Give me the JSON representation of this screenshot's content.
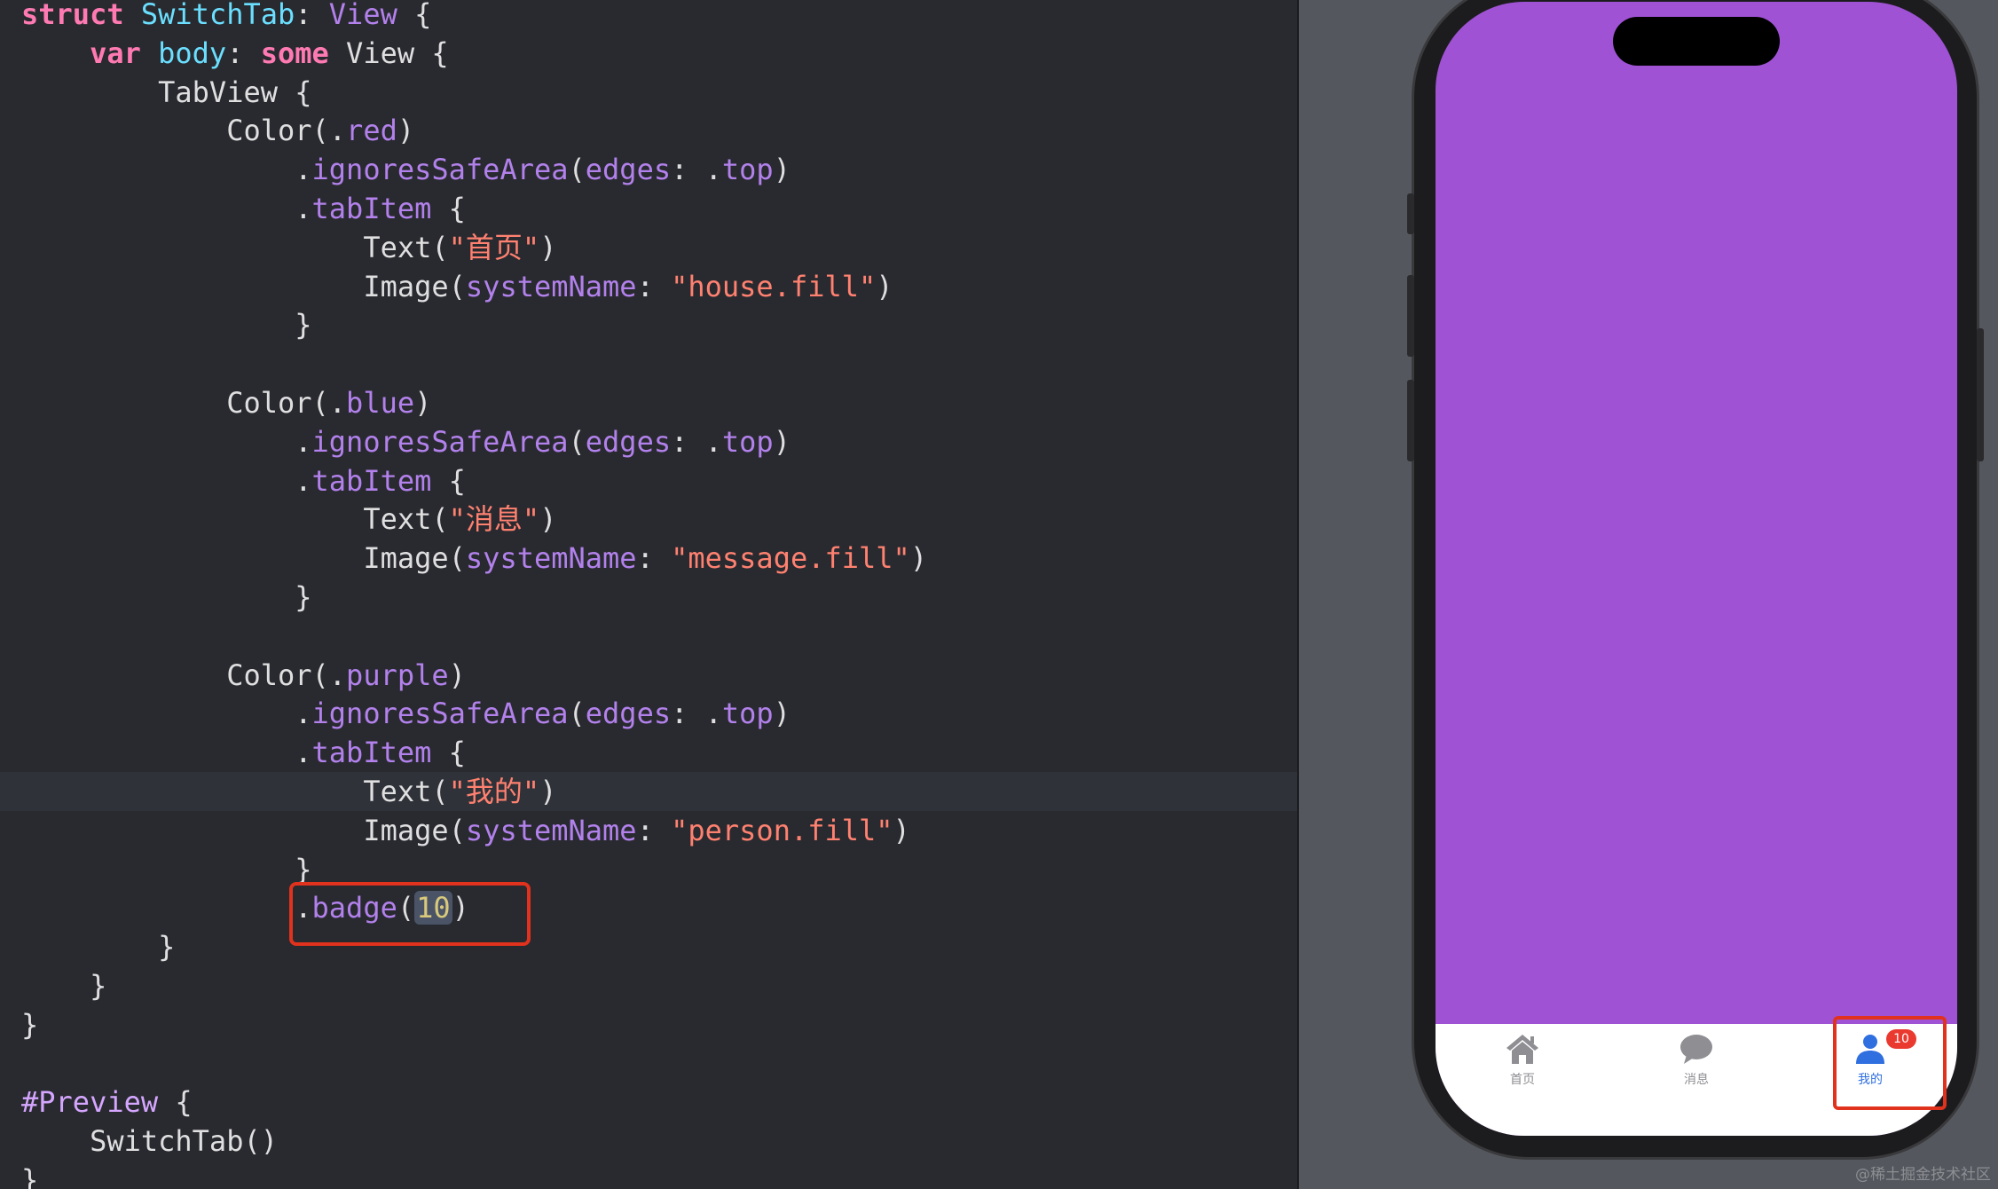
{
  "editor": {
    "lines": [
      [
        {
          "t": "struct",
          "c": "kw"
        },
        {
          "t": " ",
          "c": "pl"
        },
        {
          "t": "SwitchTab",
          "c": "id"
        },
        {
          "t": ": ",
          "c": "pl"
        },
        {
          "t": "View",
          "c": "fn"
        },
        {
          "t": " {",
          "c": "pl"
        }
      ],
      [
        {
          "t": "    ",
          "c": "pl"
        },
        {
          "t": "var",
          "c": "kw"
        },
        {
          "t": " ",
          "c": "pl"
        },
        {
          "t": "body",
          "c": "id"
        },
        {
          "t": ": ",
          "c": "pl"
        },
        {
          "t": "some",
          "c": "kw"
        },
        {
          "t": " View {",
          "c": "pl"
        }
      ],
      [
        {
          "t": "        TabView {",
          "c": "pl"
        }
      ],
      [
        {
          "t": "            Color(.",
          "c": "pl"
        },
        {
          "t": "red",
          "c": "fn"
        },
        {
          "t": ")",
          "c": "pl"
        }
      ],
      [
        {
          "t": "                .",
          "c": "pl"
        },
        {
          "t": "ignoresSafeArea",
          "c": "fn"
        },
        {
          "t": "(",
          "c": "pl"
        },
        {
          "t": "edges",
          "c": "fn"
        },
        {
          "t": ": .",
          "c": "pl"
        },
        {
          "t": "top",
          "c": "fn"
        },
        {
          "t": ")",
          "c": "pl"
        }
      ],
      [
        {
          "t": "                .",
          "c": "pl"
        },
        {
          "t": "tabItem",
          "c": "fn"
        },
        {
          "t": " {",
          "c": "pl"
        }
      ],
      [
        {
          "t": "                    Text(",
          "c": "pl"
        },
        {
          "t": "\"首页\"",
          "c": "str"
        },
        {
          "t": ")",
          "c": "pl"
        }
      ],
      [
        {
          "t": "                    Image(",
          "c": "pl"
        },
        {
          "t": "systemName",
          "c": "fn"
        },
        {
          "t": ": ",
          "c": "pl"
        },
        {
          "t": "\"house.fill\"",
          "c": "str"
        },
        {
          "t": ")",
          "c": "pl"
        }
      ],
      [
        {
          "t": "                }",
          "c": "pl"
        }
      ],
      [
        {
          "t": "",
          "c": "pl"
        }
      ],
      [
        {
          "t": "            Color(.",
          "c": "pl"
        },
        {
          "t": "blue",
          "c": "fn"
        },
        {
          "t": ")",
          "c": "pl"
        }
      ],
      [
        {
          "t": "                .",
          "c": "pl"
        },
        {
          "t": "ignoresSafeArea",
          "c": "fn"
        },
        {
          "t": "(",
          "c": "pl"
        },
        {
          "t": "edges",
          "c": "fn"
        },
        {
          "t": ": .",
          "c": "pl"
        },
        {
          "t": "top",
          "c": "fn"
        },
        {
          "t": ")",
          "c": "pl"
        }
      ],
      [
        {
          "t": "                .",
          "c": "pl"
        },
        {
          "t": "tabItem",
          "c": "fn"
        },
        {
          "t": " {",
          "c": "pl"
        }
      ],
      [
        {
          "t": "                    Text(",
          "c": "pl"
        },
        {
          "t": "\"消息\"",
          "c": "str"
        },
        {
          "t": ")",
          "c": "pl"
        }
      ],
      [
        {
          "t": "                    Image(",
          "c": "pl"
        },
        {
          "t": "systemName",
          "c": "fn"
        },
        {
          "t": ": ",
          "c": "pl"
        },
        {
          "t": "\"message.fill\"",
          "c": "str"
        },
        {
          "t": ")",
          "c": "pl"
        }
      ],
      [
        {
          "t": "                }",
          "c": "pl"
        }
      ],
      [
        {
          "t": "",
          "c": "pl"
        }
      ],
      [
        {
          "t": "            Color(.",
          "c": "pl"
        },
        {
          "t": "purple",
          "c": "fn"
        },
        {
          "t": ")",
          "c": "pl"
        }
      ],
      [
        {
          "t": "                .",
          "c": "pl"
        },
        {
          "t": "ignoresSafeArea",
          "c": "fn"
        },
        {
          "t": "(",
          "c": "pl"
        },
        {
          "t": "edges",
          "c": "fn"
        },
        {
          "t": ": .",
          "c": "pl"
        },
        {
          "t": "top",
          "c": "fn"
        },
        {
          "t": ")",
          "c": "pl"
        }
      ],
      [
        {
          "t": "                .",
          "c": "pl"
        },
        {
          "t": "tabItem",
          "c": "fn"
        },
        {
          "t": " {",
          "c": "pl"
        }
      ],
      [
        {
          "t": "                    Text(",
          "c": "pl"
        },
        {
          "t": "\"我的\"",
          "c": "str"
        },
        {
          "t": ")",
          "c": "pl"
        }
      ],
      [
        {
          "t": "                    Image(",
          "c": "pl"
        },
        {
          "t": "systemName",
          "c": "fn"
        },
        {
          "t": ": ",
          "c": "pl"
        },
        {
          "t": "\"person.fill\"",
          "c": "str"
        },
        {
          "t": ")",
          "c": "pl"
        }
      ],
      [
        {
          "t": "                }",
          "c": "pl"
        }
      ],
      [
        {
          "t": "                .",
          "c": "pl"
        },
        {
          "t": "badge",
          "c": "fn"
        },
        {
          "t": "(",
          "c": "pl"
        },
        {
          "t": "10",
          "c": "num",
          "sel": true
        },
        {
          "t": ")",
          "c": "pl"
        }
      ],
      [
        {
          "t": "        }",
          "c": "pl"
        }
      ],
      [
        {
          "t": "    }",
          "c": "pl"
        }
      ],
      [
        {
          "t": "}",
          "c": "pl"
        }
      ],
      [
        {
          "t": "",
          "c": "pl"
        }
      ],
      [
        {
          "t": "#Preview",
          "c": "dir"
        },
        {
          "t": " {",
          "c": "pl"
        }
      ],
      [
        {
          "t": "    SwitchTab()",
          "c": "pl"
        }
      ],
      [
        {
          "t": "}",
          "c": "pl"
        }
      ]
    ],
    "highlighted_line": 20
  },
  "preview": {
    "screen_color": "#a052d5",
    "tabs": [
      {
        "label": "首页",
        "icon": "house-icon",
        "color": "#8e8e93",
        "selected": false
      },
      {
        "label": "消息",
        "icon": "message-icon",
        "color": "#8e8e93",
        "selected": false
      },
      {
        "label": "我的",
        "icon": "person-icon",
        "color": "#2f6fe0",
        "selected": true
      }
    ],
    "badge": "10"
  },
  "watermark": "@稀土掘金技术社区"
}
